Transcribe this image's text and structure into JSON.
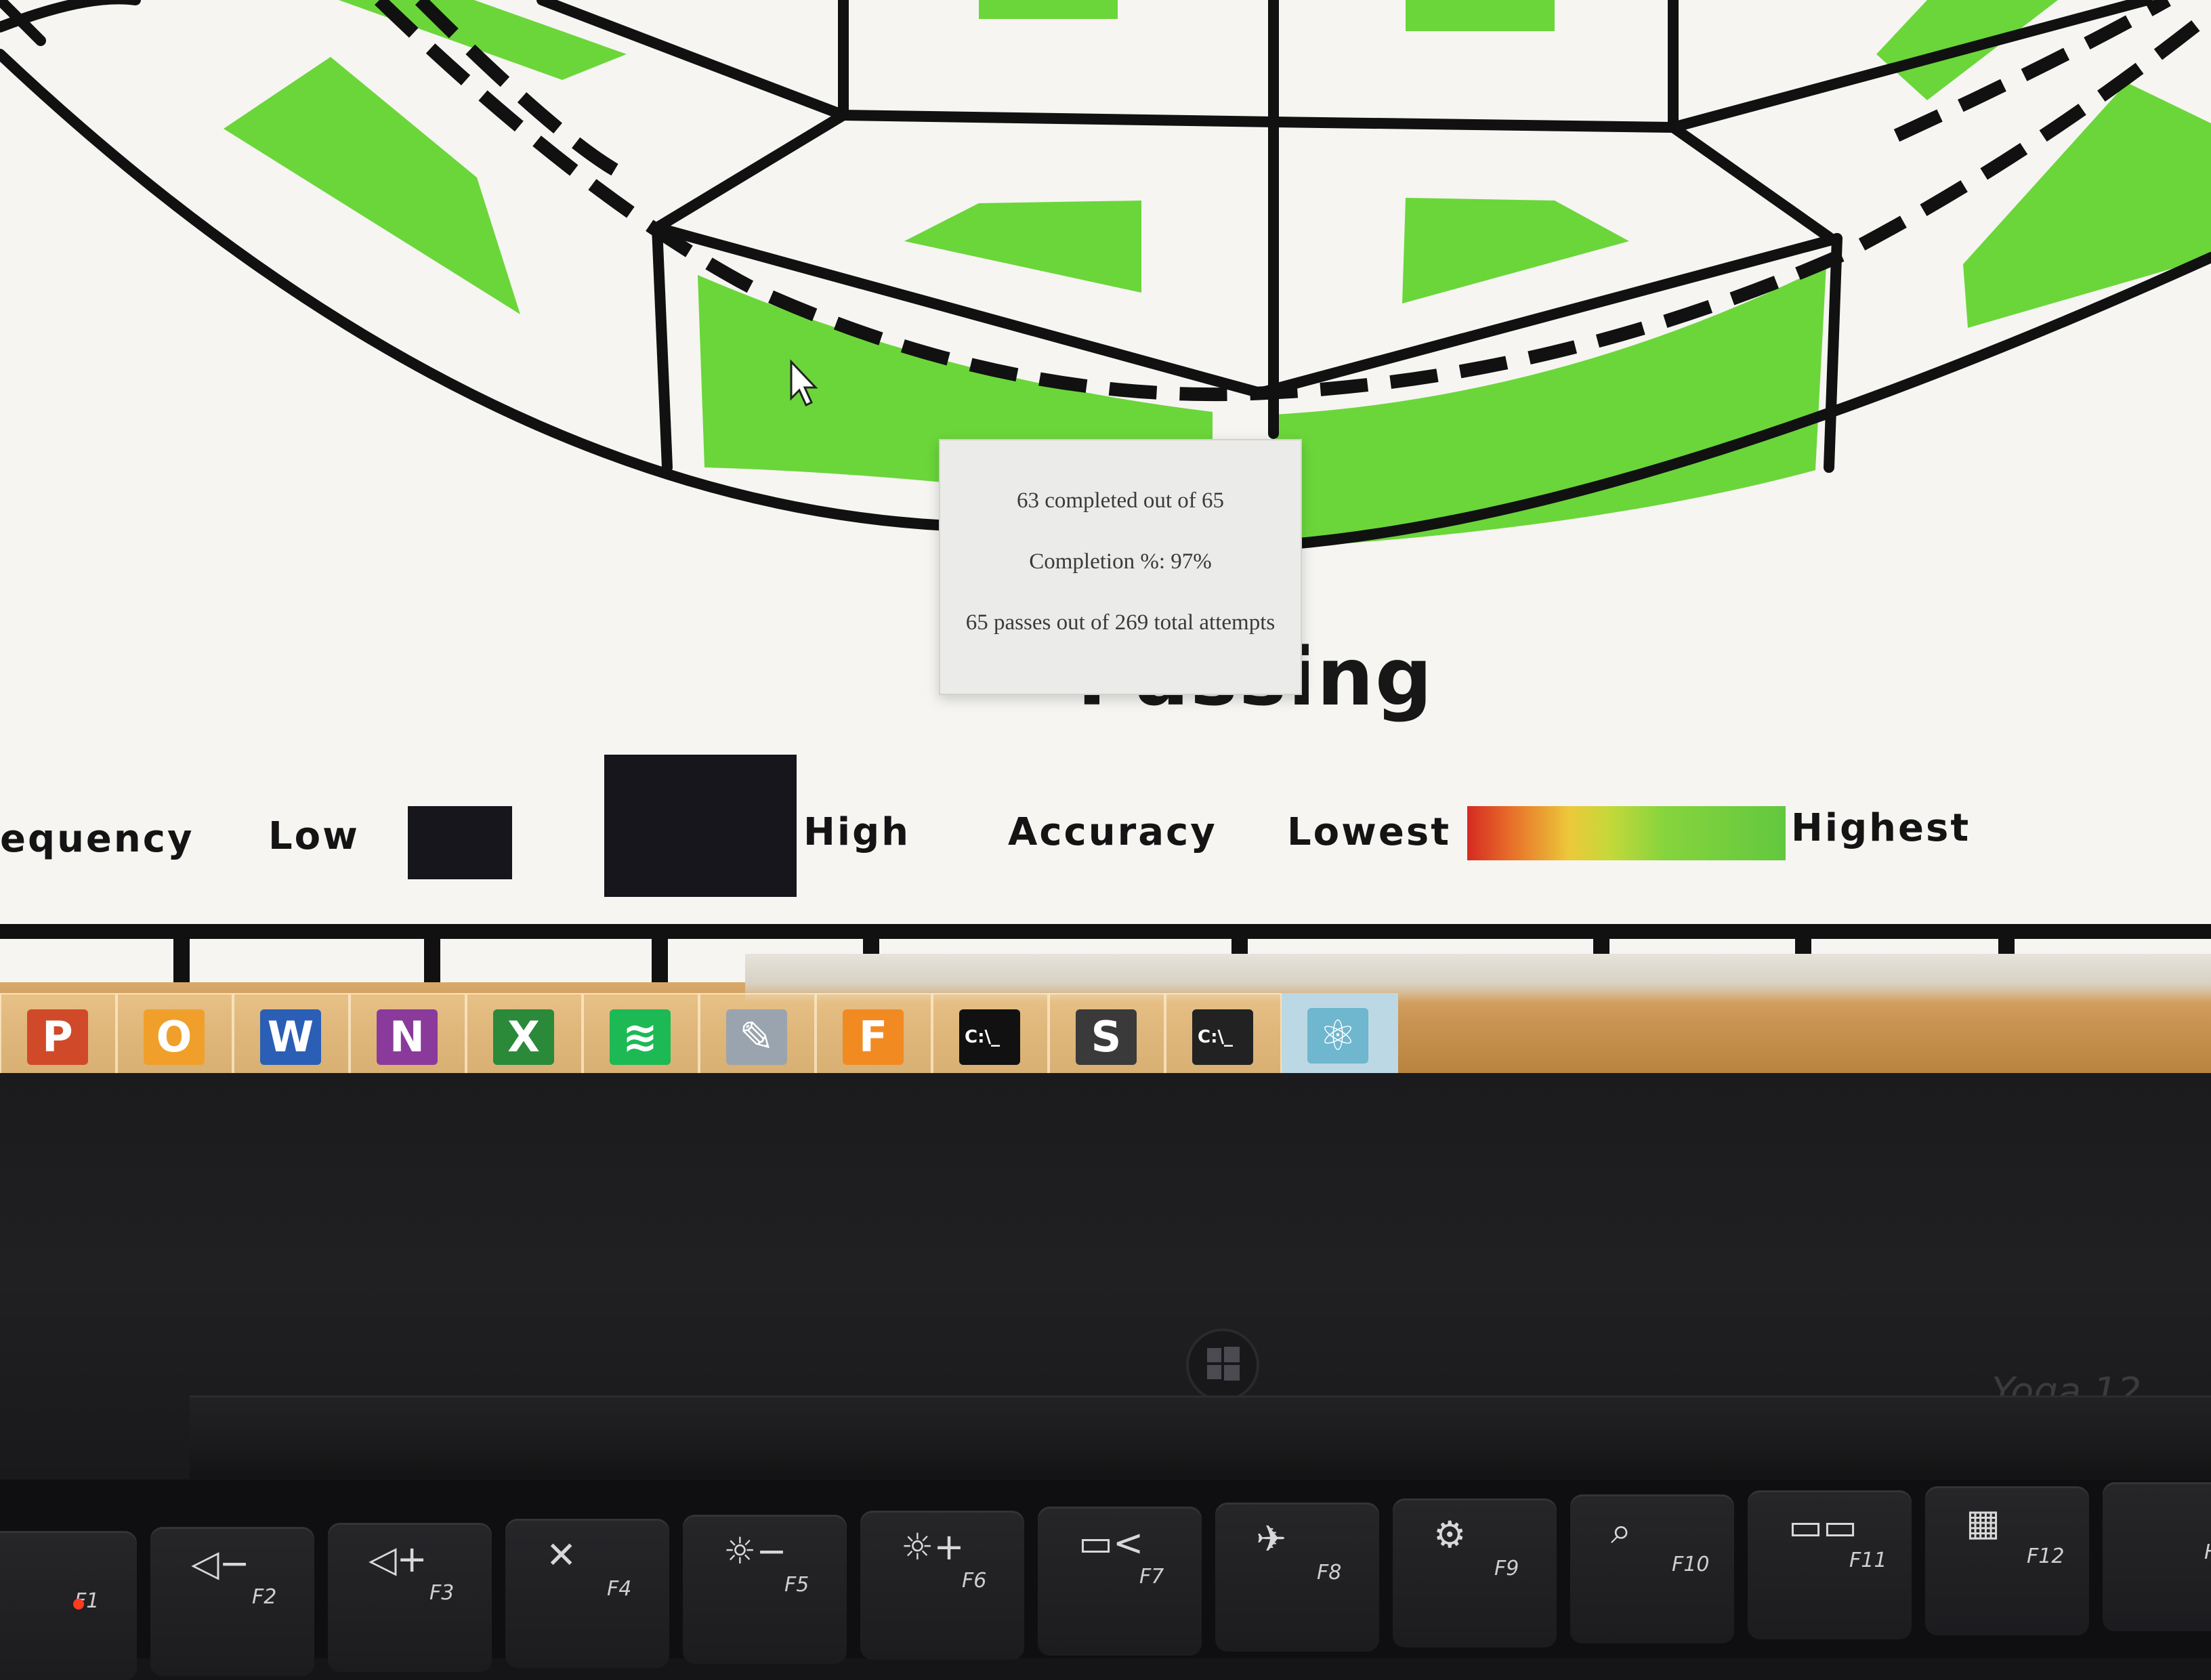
{
  "field": {
    "zone_fill": "#6bd63a",
    "line_color": "#111111",
    "background": "#f6f5f2"
  },
  "tooltip": {
    "line1": "63 completed out of 65",
    "line2": "Completion %: 97%",
    "line3": "65 passes out of 269 total attempts"
  },
  "chart_title": "Passing",
  "legend": {
    "frequency_label": "equency",
    "low_label": "Low",
    "high_label": "High",
    "accuracy_label": "Accuracy",
    "lowest_label": "Lowest",
    "highest_label": "Highest",
    "gradient_colors": [
      "#d52a21",
      "#ecc83a",
      "#62c83e"
    ]
  },
  "taskbar": {
    "apps": [
      {
        "name": "powerpoint",
        "glyph": "P",
        "color": "#d04a2a"
      },
      {
        "name": "outlook",
        "glyph": "O",
        "color": "#f0a02a"
      },
      {
        "name": "word",
        "glyph": "W",
        "color": "#2b5fb5"
      },
      {
        "name": "onenote",
        "glyph": "N",
        "color": "#8a3a9a"
      },
      {
        "name": "excel",
        "glyph": "X",
        "color": "#2a8a3a"
      },
      {
        "name": "spotify",
        "glyph": "≋",
        "color": "#1db954"
      },
      {
        "name": "notepad",
        "glyph": "✎",
        "color": "#9aa4ae"
      },
      {
        "name": "fusion-360",
        "glyph": "F",
        "color": "#f28a22"
      },
      {
        "name": "command-prompt",
        "glyph": "C:\\_",
        "color": "#111111"
      },
      {
        "name": "sublime-text",
        "glyph": "S",
        "color": "#3a3a3a"
      },
      {
        "name": "command-prompt-2",
        "glyph": "C:\\_",
        "color": "#222222"
      },
      {
        "name": "atom",
        "glyph": "⚛",
        "color": "#6fb6cf"
      }
    ]
  },
  "laptop": {
    "model": "Yoga 12"
  },
  "fkeys": [
    {
      "label": "F1",
      "symbol": "",
      "icon": "fn-lock-icon"
    },
    {
      "label": "F2",
      "symbol": "◁−",
      "icon": "volume-down-icon"
    },
    {
      "label": "F3",
      "symbol": "◁+",
      "icon": "volume-up-icon"
    },
    {
      "label": "F4",
      "symbol": "✕",
      "icon": "mic-mute-icon"
    },
    {
      "label": "F5",
      "symbol": "☼−",
      "icon": "brightness-down-icon"
    },
    {
      "label": "F6",
      "symbol": "☼+",
      "icon": "brightness-up-icon"
    },
    {
      "label": "F7",
      "symbol": "▭<",
      "icon": "display-icon"
    },
    {
      "label": "F8",
      "symbol": "✈",
      "icon": "wireless-icon"
    },
    {
      "label": "F9",
      "symbol": "⚙",
      "icon": "settings-icon"
    },
    {
      "label": "F10",
      "symbol": "⌕",
      "icon": "search-icon"
    },
    {
      "label": "F11",
      "symbol": "▭▭",
      "icon": "switch-window-icon"
    },
    {
      "label": "F12",
      "symbol": "▦",
      "icon": "all-apps-icon"
    },
    {
      "label": "Ho",
      "symbol": "",
      "icon": "home-key"
    }
  ]
}
